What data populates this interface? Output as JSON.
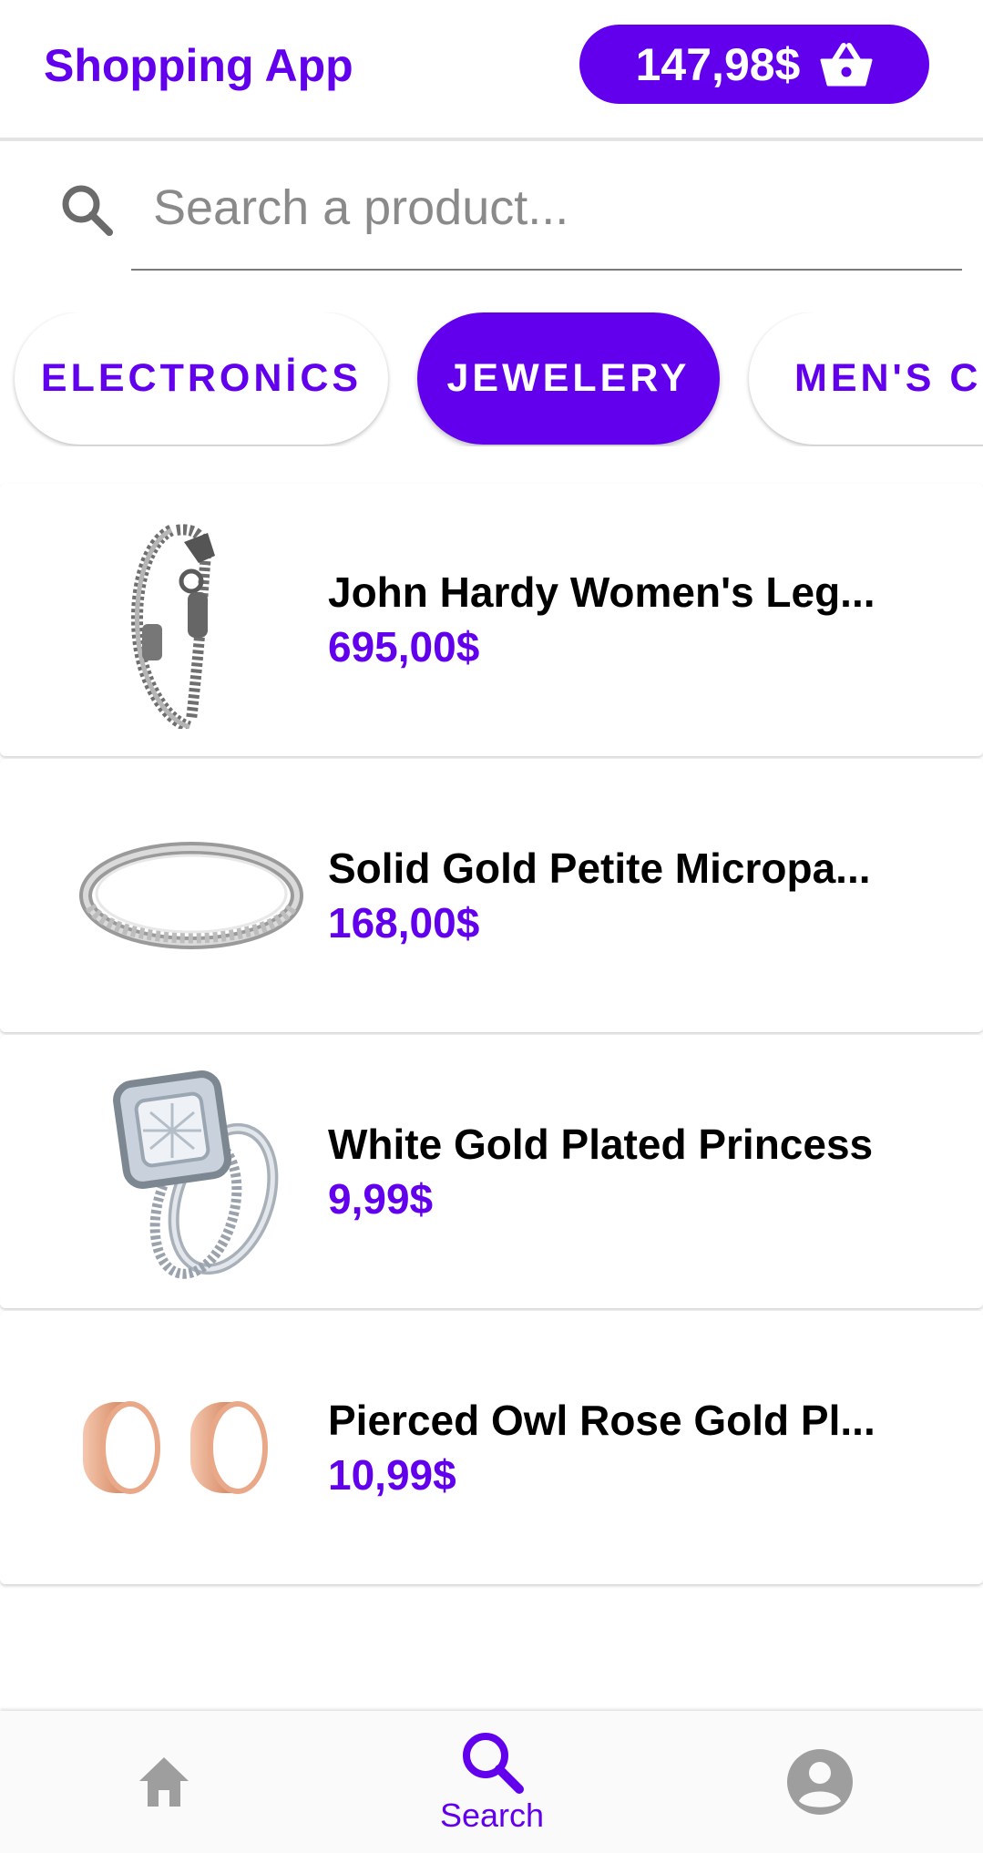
{
  "header": {
    "title": "Shopping App",
    "cart_total": "147,98$",
    "cart_icon": "basket-icon"
  },
  "search": {
    "placeholder": "Search a product...",
    "icon": "search-icon"
  },
  "categories": [
    {
      "label": "ELECTRONİCS",
      "selected": false
    },
    {
      "label": "JEWELERY",
      "selected": true
    },
    {
      "label": "MEN'S CL",
      "selected": false
    }
  ],
  "products": [
    {
      "name": "John Hardy Women's Leg...",
      "price": "695,00$",
      "image": "chain-bracelet"
    },
    {
      "name": "Solid Gold Petite Micropa...",
      "price": "168,00$",
      "image": "diamond-band-ring"
    },
    {
      "name": "White Gold Plated Princess",
      "price": "9,99$",
      "image": "halo-engagement-ring"
    },
    {
      "name": "Pierced Owl Rose Gold Pl...",
      "price": "10,99$",
      "image": "rose-gold-plugs"
    }
  ],
  "bottom_nav": {
    "items": [
      {
        "icon": "home-icon",
        "label": "",
        "active": false
      },
      {
        "icon": "search-icon",
        "label": "Search",
        "active": true
      },
      {
        "icon": "account-icon",
        "label": "",
        "active": false
      }
    ]
  },
  "colors": {
    "accent": "#6200ee",
    "inactive_icon": "#9e9e9e",
    "divider": "#e4e4e4"
  }
}
